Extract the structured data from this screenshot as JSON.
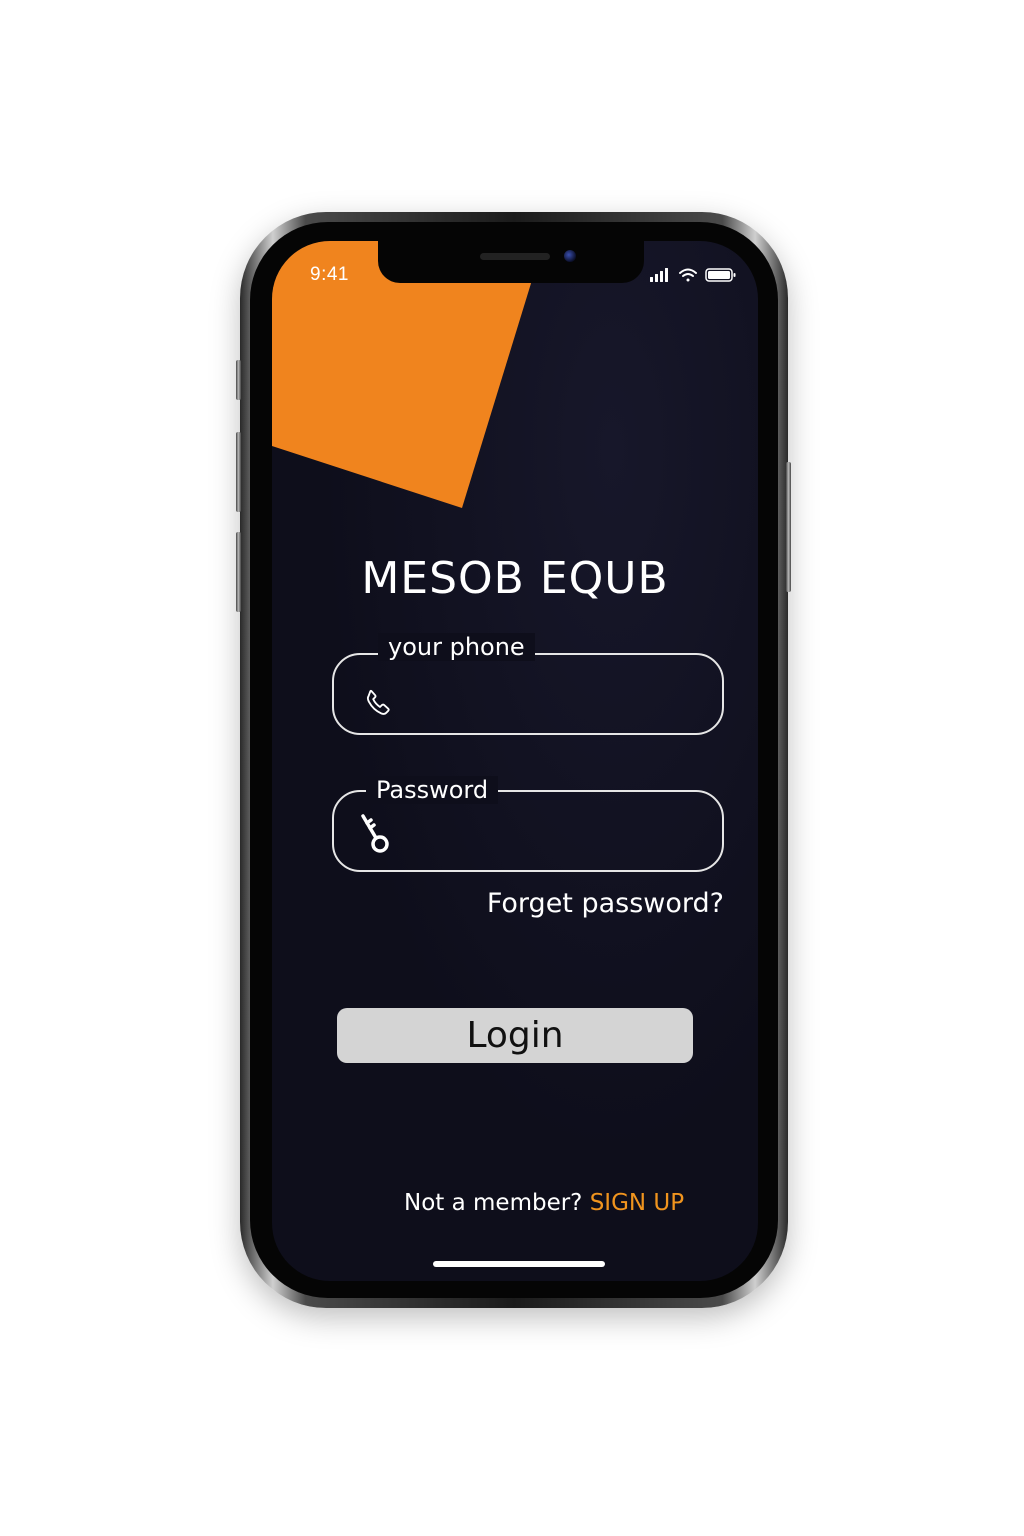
{
  "status_bar": {
    "time": "9:41",
    "icons": [
      "signal-icon",
      "wifi-icon",
      "battery-icon"
    ]
  },
  "app": {
    "title": "MESOB EQUB"
  },
  "login_form": {
    "phone_label": "your phone",
    "phone_value": "",
    "phone_icon": "phone-icon",
    "password_label": "Password",
    "password_value": "",
    "password_icon": "key-icon",
    "forget_password": "Forget password?",
    "login_button": "Login"
  },
  "signup": {
    "prompt": "Not a member?",
    "link": "SIGN UP"
  },
  "colors": {
    "accent": "#f0841e",
    "background": "#0e0e1b",
    "button": "#d4d4d4",
    "link": "#f0941e"
  }
}
